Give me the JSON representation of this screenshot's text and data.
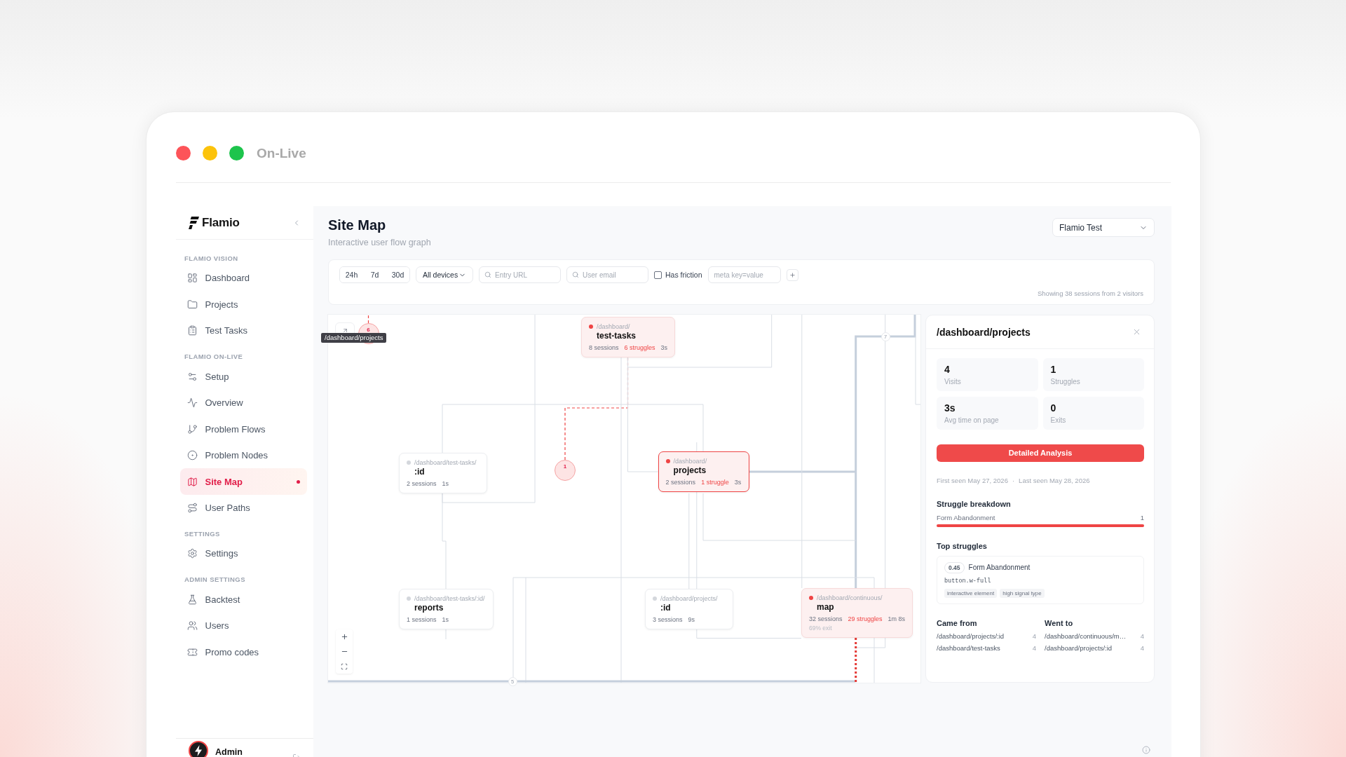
{
  "window": {
    "title": "On-Live"
  },
  "sidebar": {
    "brand": "Flamio",
    "sections": [
      {
        "title": "FLAMIO VISION",
        "items": [
          {
            "label": "Dashboard",
            "selected": false
          },
          {
            "label": "Projects",
            "selected": false
          },
          {
            "label": "Test Tasks",
            "selected": false
          }
        ]
      },
      {
        "title": "FLAMIO ON-LIVE",
        "items": [
          {
            "label": "Setup",
            "selected": false
          },
          {
            "label": "Overview",
            "selected": false
          },
          {
            "label": "Problem Flows",
            "selected": false
          },
          {
            "label": "Problem Nodes",
            "selected": false
          },
          {
            "label": "Site Map",
            "selected": true
          },
          {
            "label": "User Paths",
            "selected": false
          }
        ]
      },
      {
        "title": "SETTINGS",
        "items": [
          {
            "label": "Settings",
            "selected": false
          }
        ]
      },
      {
        "title": "ADMIN SETTINGS",
        "items": [
          {
            "label": "Backtest",
            "selected": false
          },
          {
            "label": "Users",
            "selected": false
          },
          {
            "label": "Promo codes",
            "selected": false
          }
        ]
      }
    ],
    "user": {
      "name": "Admin"
    }
  },
  "header": {
    "title": "Site Map",
    "subtitle": "Interactive user flow graph",
    "project_select": {
      "value": "Flamio Test"
    }
  },
  "filters": {
    "ranges": [
      {
        "label": "24h",
        "selected": false
      },
      {
        "label": "7d",
        "selected": false
      },
      {
        "label": "30d",
        "selected": false
      }
    ],
    "device_select": {
      "value": "All devices"
    },
    "entry_url": {
      "placeholder": "Entry URL"
    },
    "user_email": {
      "placeholder": "User email"
    },
    "has_friction": {
      "label": "Has friction",
      "checked": false
    },
    "meta_filter": {
      "placeholder": "meta key=value"
    },
    "summary": "Showing 38 sessions from 2 visitors"
  },
  "graph": {
    "tooltip": "/dashboard/projects",
    "markers": [
      {
        "count": "6"
      },
      {
        "count": "1"
      }
    ],
    "nodes": [
      {
        "path": "/dashboard/",
        "name": "test-tasks",
        "sessions": "8 sessions",
        "struggles": "6 struggles",
        "time": "3s",
        "friction": true,
        "selected": false
      },
      {
        "path": "/dashboard/test-tasks/",
        "name": ":id",
        "sessions": "2 sessions",
        "time": "1s",
        "friction": false,
        "selected": false
      },
      {
        "path": "/dashboard/",
        "name": "projects",
        "sessions": "2 sessions",
        "struggles": "1 struggle",
        "time": "3s",
        "friction": true,
        "selected": true
      },
      {
        "path": "/dashboard/test-tasks/:id/",
        "name": "reports",
        "sessions": "1 sessions",
        "time": "1s",
        "friction": false,
        "selected": false
      },
      {
        "path": "/dashboard/projects/",
        "name": ":id",
        "sessions": "3 sessions",
        "time": "9s",
        "friction": false,
        "selected": false
      },
      {
        "path": "/dashboard/continuous/",
        "name": "map",
        "sessions": "32 sessions",
        "struggles": "29 struggles",
        "time": "1m 8s",
        "exit": "69% exit",
        "friction": true,
        "selected": false
      }
    ],
    "edges": [
      {
        "kind": "normal"
      },
      {
        "kind": "normal"
      },
      {
        "kind": "normal"
      },
      {
        "kind": "normal"
      },
      {
        "kind": "friction"
      },
      {
        "kind": "friction"
      },
      {
        "kind": "normal"
      },
      {
        "kind": "normal"
      },
      {
        "kind": "normal"
      },
      {
        "kind": "thick",
        "label": "7"
      },
      {
        "kind": "thick"
      },
      {
        "kind": "normal"
      },
      {
        "kind": "normal"
      },
      {
        "kind": "normal"
      },
      {
        "kind": "normal"
      },
      {
        "kind": "normal"
      },
      {
        "kind": "normal"
      },
      {
        "kind": "normal"
      },
      {
        "kind": "normal"
      },
      {
        "kind": "thick",
        "label": "5"
      },
      {
        "kind": "exit"
      }
    ]
  },
  "detail_panel": {
    "title": "/dashboard/projects",
    "stats": [
      {
        "value": "4",
        "label": "Visits"
      },
      {
        "value": "1",
        "label": "Struggles"
      },
      {
        "value": "3s",
        "label": "Avg time on page"
      },
      {
        "value": "0",
        "label": "Exits"
      }
    ],
    "action": "Detailed Analysis",
    "first_seen": "First seen May 27, 2026",
    "separator": "·",
    "last_seen": "Last seen May 28, 2026",
    "breakdown": {
      "title": "Struggle breakdown",
      "items": [
        {
          "label": "Form Abandonment",
          "count": "1",
          "level": 1
        }
      ]
    },
    "top_struggles": {
      "title": "Top struggles",
      "items": [
        {
          "score": "0.45",
          "label": "Form Abandonment",
          "selector": "button.w-full",
          "tags": [
            "interactive element",
            "high signal type"
          ]
        }
      ]
    },
    "came_from": {
      "title": "Came from",
      "rows": [
        {
          "path": "/dashboard/projects/:id",
          "count": "4"
        },
        {
          "path": "/dashboard/test-tasks",
          "count": "4"
        }
      ]
    },
    "went_to": {
      "title": "Went to",
      "rows": [
        {
          "path": "/dashboard/continuous/m…",
          "count": "4"
        },
        {
          "path": "/dashboard/projects/:id",
          "count": "4"
        }
      ]
    }
  }
}
